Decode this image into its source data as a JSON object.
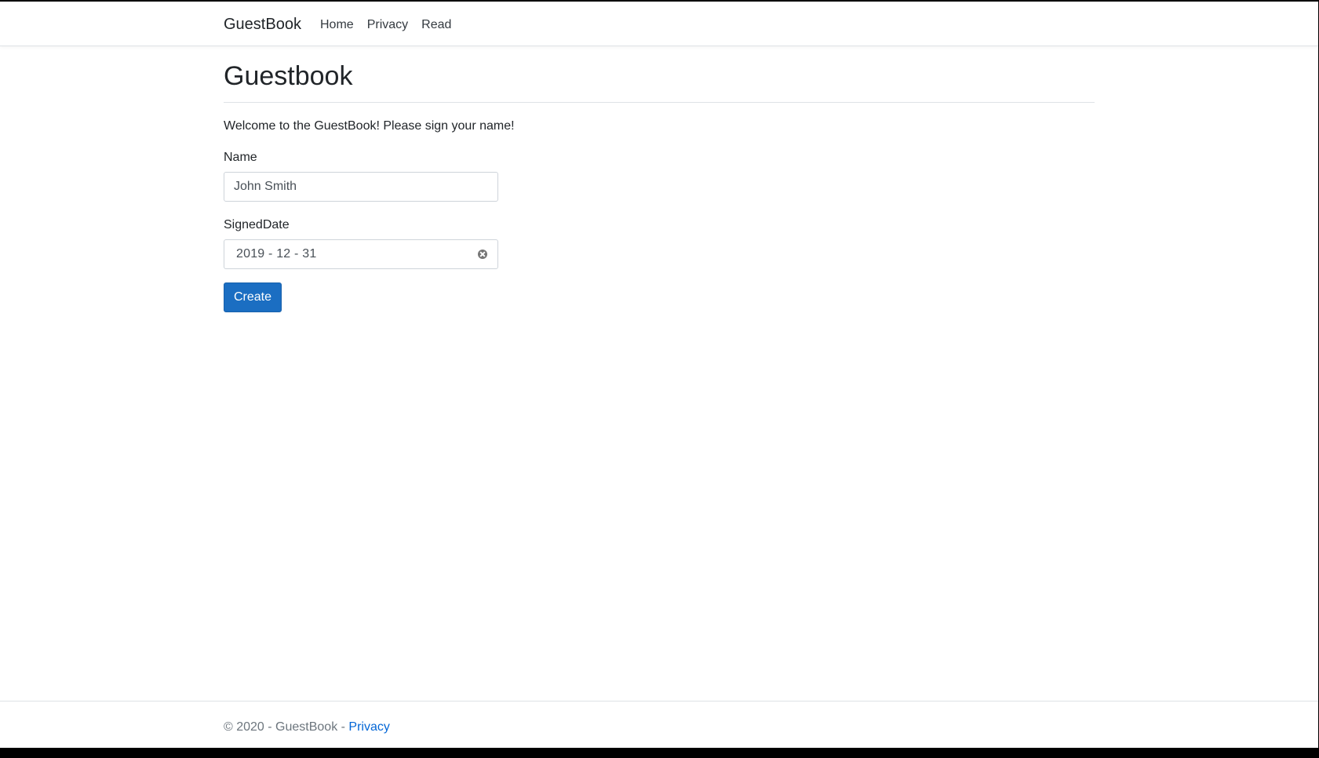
{
  "navbar": {
    "brand": "GuestBook",
    "links": [
      "Home",
      "Privacy",
      "Read"
    ]
  },
  "main": {
    "title": "Guestbook",
    "welcome": "Welcome to the GuestBook! Please sign your name!",
    "form": {
      "name_label": "Name",
      "name_value": "John Smith",
      "date_label": "SignedDate",
      "date_value": "2019 - 12 - 31",
      "submit_label": "Create"
    }
  },
  "footer": {
    "copyright": "© 2020 - GuestBook - ",
    "privacy_link": "Privacy"
  },
  "colors": {
    "primary_button": "#1b6ec2",
    "link": "#0366d6",
    "footer_text": "#6c757d"
  },
  "icons": {
    "date_clear": "clear-circle-x-icon"
  }
}
